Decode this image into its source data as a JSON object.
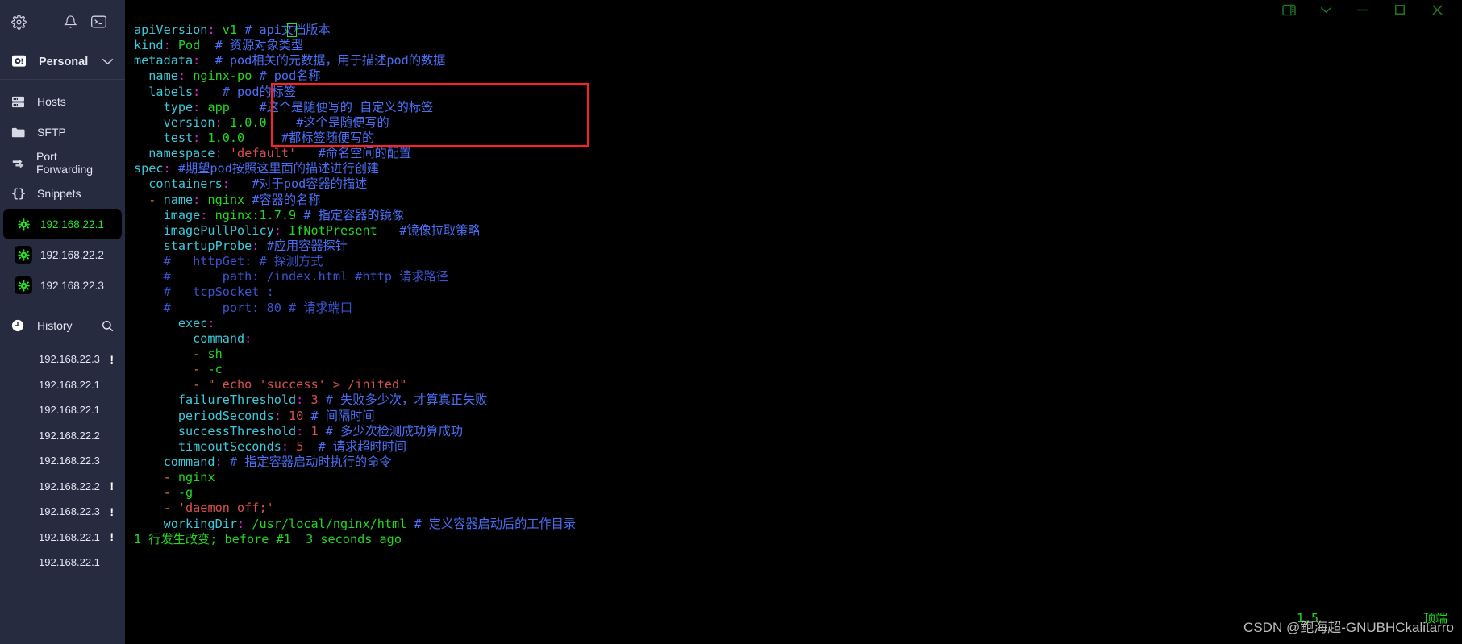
{
  "sidebar": {
    "toolbar": [
      {
        "name": "settings-icon",
        "label": "Settings"
      },
      {
        "name": "notifications-icon",
        "label": "Notifications"
      },
      {
        "name": "terminal-icon",
        "label": "Terminal"
      }
    ],
    "account": {
      "label": "Personal",
      "icon": "vault-icon",
      "chevron": "chevron-down-icon"
    },
    "nav": [
      {
        "label": "Hosts",
        "icon": "server-icon"
      },
      {
        "label": "SFTP",
        "icon": "folder-icon"
      },
      {
        "label": "Port Forwarding",
        "icon": "arrows-icon"
      },
      {
        "label": "Snippets",
        "icon": "braces-icon"
      }
    ],
    "hosts": [
      {
        "label": "192.168.22.1",
        "active": true
      },
      {
        "label": "192.168.22.2",
        "active": false
      },
      {
        "label": "192.168.22.3",
        "active": false
      }
    ],
    "history": {
      "label": "History",
      "icon": "clock-icon",
      "search_icon": "search-icon",
      "items": [
        {
          "label": "192.168.22.3",
          "warn": "!"
        },
        {
          "label": "192.168.22.1",
          "warn": ""
        },
        {
          "label": "192.168.22.1",
          "warn": ""
        },
        {
          "label": "192.168.22.2",
          "warn": ""
        },
        {
          "label": "192.168.22.3",
          "warn": ""
        },
        {
          "label": "192.168.22.2",
          "warn": "!"
        },
        {
          "label": "192.168.22.3",
          "warn": "!"
        },
        {
          "label": "192.168.22.1",
          "warn": "!"
        },
        {
          "label": "192.168.22.1",
          "warn": ""
        }
      ]
    }
  },
  "titlebar": {
    "buttons": [
      {
        "name": "split-pane-button",
        "glyph": "split"
      },
      {
        "name": "dropdown-button",
        "glyph": "chev"
      },
      {
        "name": "minimize-button",
        "glyph": "min"
      },
      {
        "name": "maximize-button",
        "glyph": "max"
      },
      {
        "name": "close-button",
        "glyph": "close"
      }
    ]
  },
  "terminal": {
    "status_line": "1 行发生改变; before #1  3 seconds ago",
    "ruler_position": "1,5",
    "ruler_label": "顶端",
    "lines": [
      [
        {
          "t": "apiVersion",
          "s": "k"
        },
        {
          "t": ":",
          "s": "c"
        },
        {
          "t": " ",
          "s": ""
        },
        {
          "t": "v1",
          "s": "v"
        },
        {
          "t": " ",
          "s": ""
        },
        {
          "t": "# api文档版本",
          "s": "cm"
        }
      ],
      [
        {
          "t": "kind",
          "s": "k"
        },
        {
          "t": ":",
          "s": "c"
        },
        {
          "t": " ",
          "s": ""
        },
        {
          "t": "Pod",
          "s": "v"
        },
        {
          "t": "  ",
          "s": ""
        },
        {
          "t": "# 资源对象类型",
          "s": "cm"
        }
      ],
      [
        {
          "t": "metadata",
          "s": "k"
        },
        {
          "t": ":",
          "s": "c"
        },
        {
          "t": "  ",
          "s": ""
        },
        {
          "t": "# pod相关的元数据，用于描述pod的数据",
          "s": "cm"
        }
      ],
      [
        {
          "t": "  name",
          "s": "k"
        },
        {
          "t": ":",
          "s": "c"
        },
        {
          "t": " ",
          "s": ""
        },
        {
          "t": "nginx-po",
          "s": "v"
        },
        {
          "t": " ",
          "s": ""
        },
        {
          "t": "# pod名称",
          "s": "cm"
        }
      ],
      [
        {
          "t": "  labels",
          "s": "k"
        },
        {
          "t": ":",
          "s": "c"
        },
        {
          "t": "   ",
          "s": ""
        },
        {
          "t": "# pod的标签",
          "s": "cm"
        }
      ],
      [
        {
          "t": "    type",
          "s": "k"
        },
        {
          "t": ":",
          "s": "c"
        },
        {
          "t": " ",
          "s": ""
        },
        {
          "t": "app",
          "s": "v"
        },
        {
          "t": "    ",
          "s": ""
        },
        {
          "t": "#这个是随便写的 自定义的标签",
          "s": "cm"
        }
      ],
      [
        {
          "t": "    version",
          "s": "k"
        },
        {
          "t": ":",
          "s": "c"
        },
        {
          "t": " ",
          "s": ""
        },
        {
          "t": "1.0.0",
          "s": "v"
        },
        {
          "t": "    ",
          "s": ""
        },
        {
          "t": "#这个是随便写的",
          "s": "cm"
        }
      ],
      [
        {
          "t": "    test",
          "s": "k"
        },
        {
          "t": ":",
          "s": "c"
        },
        {
          "t": " ",
          "s": ""
        },
        {
          "t": "1.0.0",
          "s": "v"
        },
        {
          "t": "     ",
          "s": ""
        },
        {
          "t": "#都标签随便写的",
          "s": "cm"
        }
      ],
      [
        {
          "t": "  namespace",
          "s": "k"
        },
        {
          "t": ":",
          "s": "c"
        },
        {
          "t": " ",
          "s": ""
        },
        {
          "t": "'default'",
          "s": "str"
        },
        {
          "t": "   ",
          "s": ""
        },
        {
          "t": "#命名空间的配置",
          "s": "cm"
        }
      ],
      [
        {
          "t": "spec",
          "s": "k"
        },
        {
          "t": ":",
          "s": "c"
        },
        {
          "t": " ",
          "s": ""
        },
        {
          "t": "#期望pod按照这里面的描述进行创建",
          "s": "cm"
        }
      ],
      [
        {
          "t": "  containers",
          "s": "k"
        },
        {
          "t": ":",
          "s": "c"
        },
        {
          "t": "   ",
          "s": ""
        },
        {
          "t": "#对于pod容器的描述",
          "s": "cm"
        }
      ],
      [
        {
          "t": "  -",
          "s": "dash"
        },
        {
          "t": " ",
          "s": ""
        },
        {
          "t": "name",
          "s": "k"
        },
        {
          "t": ":",
          "s": "c"
        },
        {
          "t": " ",
          "s": ""
        },
        {
          "t": "nginx",
          "s": "v"
        },
        {
          "t": " ",
          "s": ""
        },
        {
          "t": "#容器的名称",
          "s": "cm"
        }
      ],
      [
        {
          "t": "    image",
          "s": "k"
        },
        {
          "t": ":",
          "s": "c"
        },
        {
          "t": " ",
          "s": ""
        },
        {
          "t": "nginx:1.7.9",
          "s": "v"
        },
        {
          "t": " ",
          "s": ""
        },
        {
          "t": "# 指定容器的镜像",
          "s": "cm"
        }
      ],
      [
        {
          "t": "    imagePullPolicy",
          "s": "k"
        },
        {
          "t": ":",
          "s": "c"
        },
        {
          "t": " ",
          "s": ""
        },
        {
          "t": "IfNotPresent",
          "s": "v"
        },
        {
          "t": "   ",
          "s": ""
        },
        {
          "t": "#镜像拉取策略",
          "s": "cm"
        }
      ],
      [
        {
          "t": "    startupProbe",
          "s": "k"
        },
        {
          "t": ":",
          "s": "c"
        },
        {
          "t": " ",
          "s": ""
        },
        {
          "t": "#应用容器探针",
          "s": "cm"
        }
      ],
      [
        {
          "t": "    #   httpGet: # 探测方式",
          "s": "cmd"
        }
      ],
      [
        {
          "t": "    #       path: /index.html #http 请求路径",
          "s": "cmd"
        }
      ],
      [
        {
          "t": "    #   tcpSocket :",
          "s": "cmd"
        }
      ],
      [
        {
          "t": "    #       port: 80 # 请求端口",
          "s": "cmd"
        }
      ],
      [
        {
          "t": "      exec",
          "s": "k"
        },
        {
          "t": ":",
          "s": "c"
        }
      ],
      [
        {
          "t": "        command",
          "s": "k"
        },
        {
          "t": ":",
          "s": "c"
        }
      ],
      [
        {
          "t": "        -",
          "s": "dash"
        },
        {
          "t": " ",
          "s": ""
        },
        {
          "t": "sh",
          "s": "v"
        }
      ],
      [
        {
          "t": "        -",
          "s": "dash"
        },
        {
          "t": " ",
          "s": ""
        },
        {
          "t": "-c",
          "s": "v"
        }
      ],
      [
        {
          "t": "        -",
          "s": "dash"
        },
        {
          "t": " ",
          "s": ""
        },
        {
          "t": "\" echo 'success' > /inited\"",
          "s": "str"
        }
      ],
      [
        {
          "t": "      failureThreshold",
          "s": "k"
        },
        {
          "t": ":",
          "s": "c"
        },
        {
          "t": " ",
          "s": ""
        },
        {
          "t": "3",
          "s": "num"
        },
        {
          "t": " ",
          "s": ""
        },
        {
          "t": "# 失败多少次，才算真正失败",
          "s": "cm"
        }
      ],
      [
        {
          "t": "      periodSeconds",
          "s": "k"
        },
        {
          "t": ":",
          "s": "c"
        },
        {
          "t": " ",
          "s": ""
        },
        {
          "t": "10",
          "s": "num"
        },
        {
          "t": " ",
          "s": ""
        },
        {
          "t": "# 间隔时间",
          "s": "cm"
        }
      ],
      [
        {
          "t": "      successThreshold",
          "s": "k"
        },
        {
          "t": ":",
          "s": "c"
        },
        {
          "t": " ",
          "s": ""
        },
        {
          "t": "1",
          "s": "num"
        },
        {
          "t": " ",
          "s": ""
        },
        {
          "t": "# 多少次检测成功算成功",
          "s": "cm"
        }
      ],
      [
        {
          "t": "      timeoutSeconds",
          "s": "k"
        },
        {
          "t": ":",
          "s": "c"
        },
        {
          "t": " ",
          "s": ""
        },
        {
          "t": "5",
          "s": "num"
        },
        {
          "t": "  ",
          "s": ""
        },
        {
          "t": "# 请求超时时间",
          "s": "cm"
        }
      ],
      [
        {
          "t": "    command",
          "s": "k"
        },
        {
          "t": ":",
          "s": "c"
        },
        {
          "t": " ",
          "s": ""
        },
        {
          "t": "# 指定容器启动时执行的命令",
          "s": "cm"
        }
      ],
      [
        {
          "t": "    -",
          "s": "dash"
        },
        {
          "t": " ",
          "s": ""
        },
        {
          "t": "nginx",
          "s": "v"
        }
      ],
      [
        {
          "t": "    -",
          "s": "dash"
        },
        {
          "t": " ",
          "s": ""
        },
        {
          "t": "-g",
          "s": "v"
        }
      ],
      [
        {
          "t": "    -",
          "s": "dash"
        },
        {
          "t": " ",
          "s": ""
        },
        {
          "t": "'daemon off;'",
          "s": "str"
        }
      ],
      [
        {
          "t": "    workingDir",
          "s": "k"
        },
        {
          "t": ":",
          "s": "c"
        },
        {
          "t": " ",
          "s": ""
        },
        {
          "t": "/usr/local/nginx/html",
          "s": "v"
        },
        {
          "t": " ",
          "s": ""
        },
        {
          "t": "# 定义容器启动后的工作目录",
          "s": "cm"
        }
      ]
    ]
  },
  "watermark": {
    "text": "CSDN @鲍海超-GNUBHCkalitarro"
  }
}
